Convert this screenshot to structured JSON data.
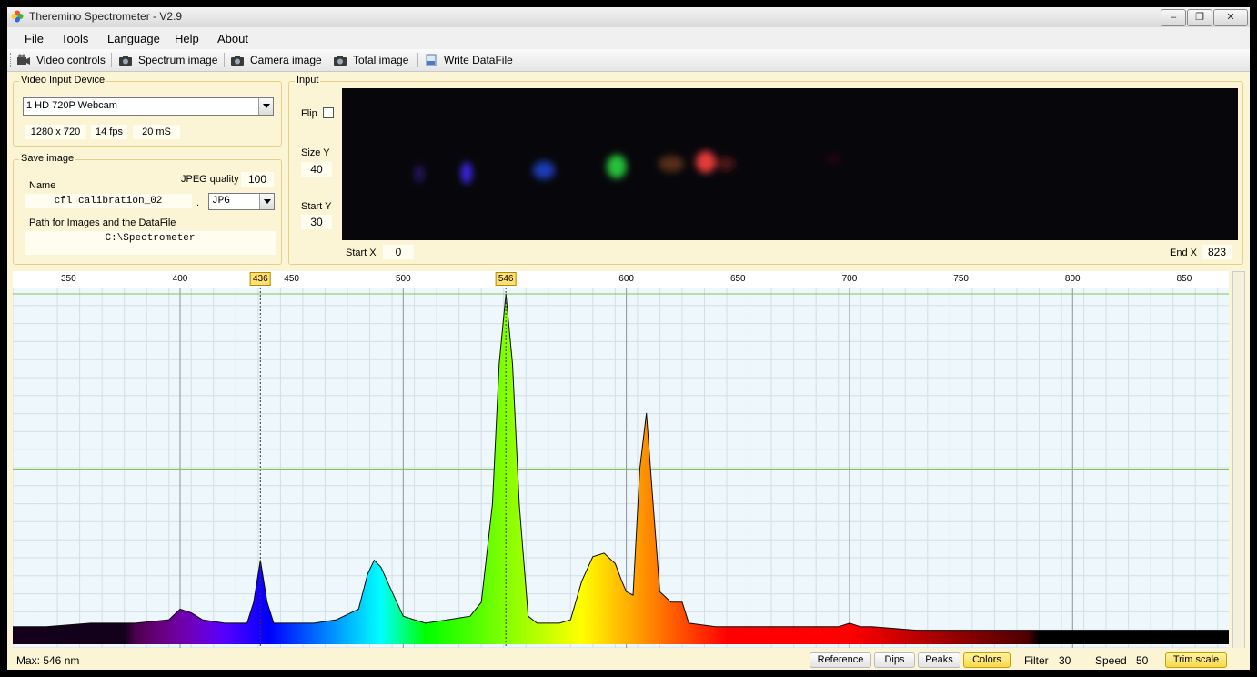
{
  "window": {
    "title": "Theremino Spectrometer - V2.9",
    "minimize": "–",
    "restore": "❐",
    "close": "✕"
  },
  "menu": [
    "File",
    "Tools",
    "Language",
    "Help",
    "About"
  ],
  "toolbar": {
    "items": [
      {
        "label": "Video controls",
        "icon": "video-camera-icon"
      },
      {
        "label": "Spectrum image",
        "icon": "camera-icon"
      },
      {
        "label": "Camera image",
        "icon": "camera-icon"
      },
      {
        "label": "Total image",
        "icon": "camera-icon"
      },
      {
        "label": "Write DataFile",
        "icon": "save-data-icon"
      }
    ]
  },
  "video_input": {
    "legend": "Video Input Device",
    "device": "1 HD 720P Webcam",
    "resolution": "1280 x 720",
    "fps": "14 fps",
    "interval": "20 mS"
  },
  "save_image": {
    "legend": "Save image",
    "jpeg_quality_label": "JPEG quality",
    "jpeg_quality": "100",
    "name_label": "Name",
    "name": "cfl calibration_02",
    "dot": ".",
    "format": "JPG",
    "path_label": "Path for Images and the DataFile",
    "path": "C:\\Spectrometer"
  },
  "input": {
    "legend": "Input",
    "flip_label": "Flip",
    "flip_checked": false,
    "size_y_label": "Size Y",
    "size_y": "40",
    "start_y_label": "Start Y",
    "start_y": "30",
    "start_x_label": "Start X",
    "start_x": "0",
    "end_x_label": "End X",
    "end_x": "823"
  },
  "chart_data": {
    "type": "area",
    "title": "",
    "xlabel": "",
    "ylabel": "",
    "xlim": [
      325,
      870
    ],
    "ylim": [
      0,
      100
    ],
    "x_ticks": [
      350,
      400,
      450,
      500,
      550,
      600,
      650,
      700,
      750,
      800,
      850
    ],
    "x_tick_labels": [
      "350",
      "400",
      "450",
      "500",
      "",
      "600",
      "650",
      "700",
      "750",
      "800",
      "850"
    ],
    "markers": [
      {
        "x": 436,
        "label": "436"
      },
      {
        "x": 546,
        "label": "546"
      }
    ],
    "grid": true,
    "series": [
      {
        "x": [
          325,
          340,
          360,
          380,
          395,
          400,
          405,
          410,
          420,
          430,
          433,
          436,
          439,
          442,
          450,
          460,
          470,
          480,
          484,
          487,
          490,
          495,
          500,
          505,
          510,
          520,
          530,
          535,
          540,
          543,
          546,
          549,
          552,
          556,
          560,
          570,
          575,
          580,
          585,
          590,
          595,
          598,
          600,
          603,
          606,
          609,
          612,
          615,
          620,
          625,
          628,
          640,
          660,
          680,
          695,
          700,
          705,
          710,
          730,
          760,
          800,
          840,
          870
        ],
        "values": [
          5,
          5,
          6,
          6,
          7,
          10,
          9,
          7,
          6,
          6,
          12,
          24,
          12,
          6,
          6,
          6,
          7,
          10,
          20,
          24,
          22,
          15,
          8,
          7,
          6,
          7,
          8,
          12,
          40,
          80,
          100,
          80,
          40,
          8,
          6,
          6,
          7,
          18,
          25,
          26,
          23,
          18,
          15,
          14,
          50,
          66,
          40,
          15,
          12,
          12,
          6,
          5,
          5,
          5,
          5,
          6,
          5,
          5,
          4,
          4,
          4,
          4,
          4
        ]
      }
    ]
  },
  "status": {
    "max": "Max: 546 nm",
    "reference": "Reference",
    "dips": "Dips",
    "peaks": "Peaks",
    "colors": "Colors",
    "filter_label": "Filter",
    "filter": "30",
    "speed_label": "Speed",
    "speed": "50",
    "trim": "Trim scale"
  }
}
